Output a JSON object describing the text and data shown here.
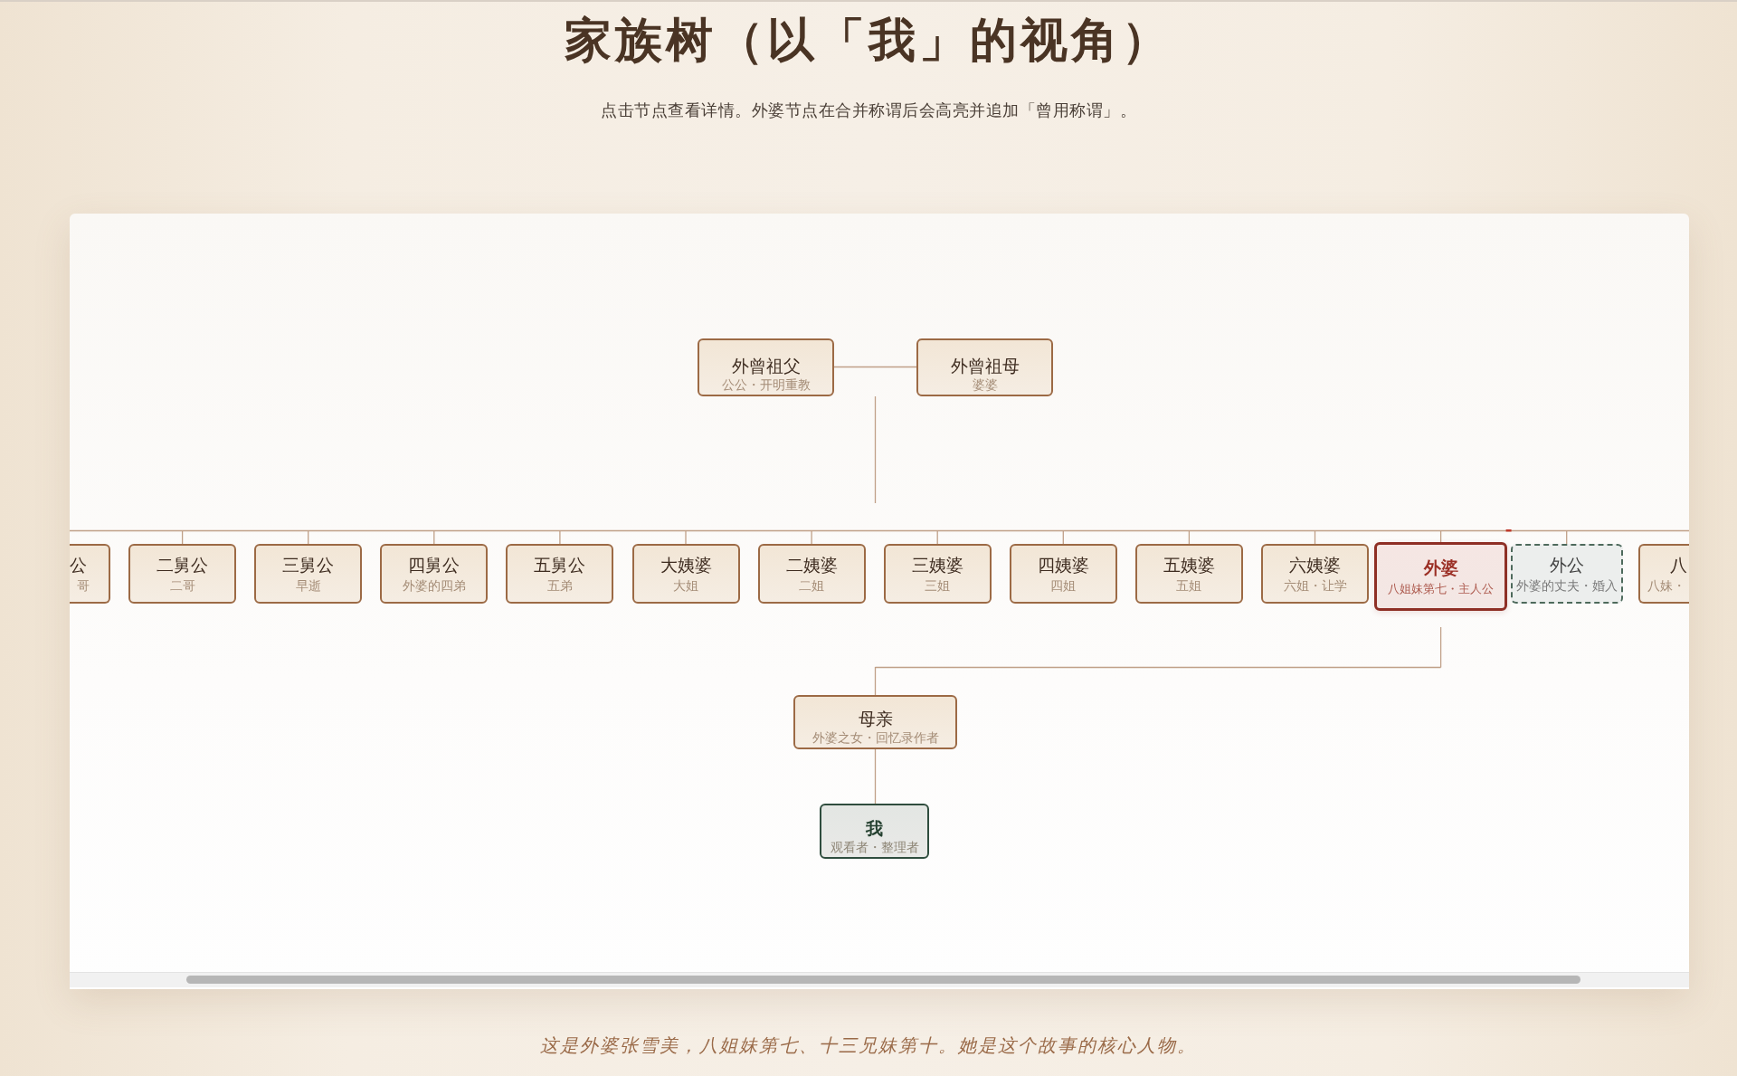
{
  "page": {
    "title": "家族树（以「我」的视角）",
    "subtitle": "点击节点查看详情。外婆节点在合并称谓后会高亮并追加「曾用称谓」。"
  },
  "tree": {
    "great_grandparents": [
      {
        "name": "外曾祖父",
        "note": "公公・开明重教"
      },
      {
        "name": "外曾祖母",
        "note": "婆婆"
      }
    ],
    "siblings": [
      {
        "name": "公",
        "note": "哥",
        "kind": "clipped_start",
        "selected": false
      },
      {
        "name": "二舅公",
        "note": "二哥",
        "kind": "blood",
        "selected": false
      },
      {
        "name": "三舅公",
        "note": "早逝",
        "kind": "blood",
        "selected": false
      },
      {
        "name": "四舅公",
        "note": "外婆的四弟",
        "kind": "blood",
        "selected": false
      },
      {
        "name": "五舅公",
        "note": "五弟",
        "kind": "blood",
        "selected": false
      },
      {
        "name": "大姨婆",
        "note": "大姐",
        "kind": "blood",
        "selected": false
      },
      {
        "name": "二姨婆",
        "note": "二姐",
        "kind": "blood",
        "selected": false
      },
      {
        "name": "三姨婆",
        "note": "三姐",
        "kind": "blood",
        "selected": false
      },
      {
        "name": "四姨婆",
        "note": "四姐",
        "kind": "blood",
        "selected": false
      },
      {
        "name": "五姨婆",
        "note": "五姐",
        "kind": "blood",
        "selected": false
      },
      {
        "name": "六姨婆",
        "note": "六姐・让学",
        "kind": "blood",
        "selected": false
      },
      {
        "name": "外婆",
        "note": "八姐妹第七・主人公",
        "kind": "blood",
        "selected": true
      },
      {
        "name": "外公",
        "note": "外婆的丈夫・婚入",
        "kind": "in_law",
        "selected": false
      },
      {
        "name": "八",
        "note": "八妹・",
        "kind": "clipped_end",
        "selected": false
      }
    ],
    "mother": {
      "name": "母亲",
      "note": "外婆之女・回忆录作者"
    },
    "me": {
      "name": "我",
      "note": "观看者・整理者"
    }
  },
  "caption": "这是外婆张雪美，八姐妹第七、十三兄妹第十。她是这个故事的核心人物。"
}
